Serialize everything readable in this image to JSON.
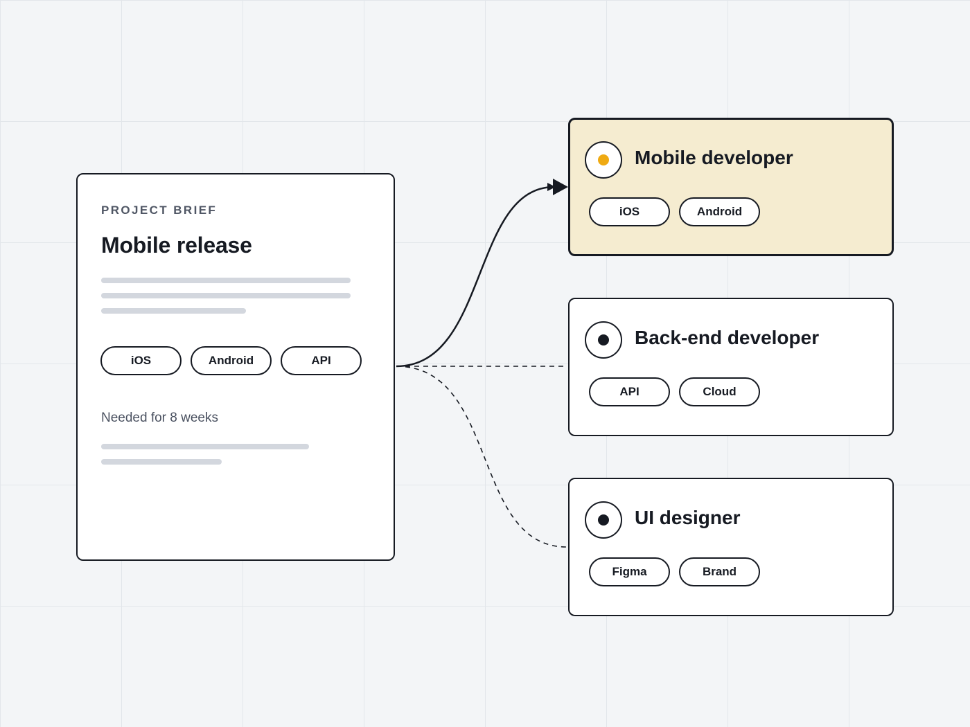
{
  "theme": {
    "canvas_background": "#f3f5f7",
    "grid_line": "#e2e6ea",
    "ink": "#161a22",
    "selected_card_background": "#f5ecd0",
    "selected_indicator": "#efaa12",
    "placeholder_line": "#d3d7de"
  },
  "brief": {
    "eyebrow": "PROJECT BRIEF",
    "title": "Mobile release",
    "tags": [
      "iOS",
      "Android",
      "API"
    ],
    "duration": "Needed for 8 weeks"
  },
  "roles": [
    {
      "title": "Mobile developer",
      "tags": [
        "iOS",
        "Android"
      ],
      "selected": true,
      "connector": "solid-arrow"
    },
    {
      "title": "Back-end developer",
      "tags": [
        "API",
        "Cloud"
      ],
      "selected": false,
      "connector": "dashed"
    },
    {
      "title": "UI designer",
      "tags": [
        "Figma",
        "Brand"
      ],
      "selected": false,
      "connector": "dashed"
    }
  ]
}
